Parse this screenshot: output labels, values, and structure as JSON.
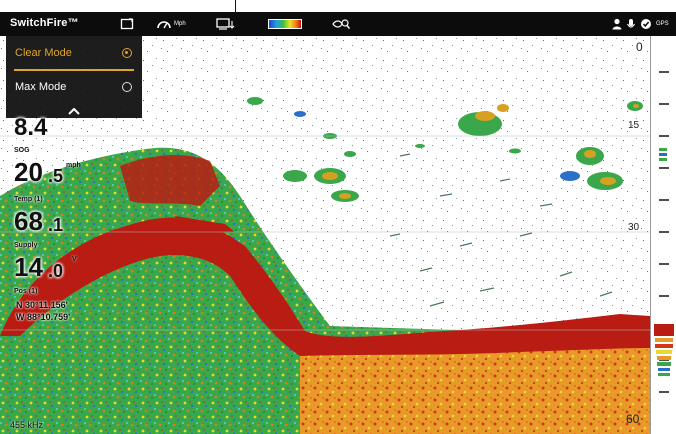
{
  "topbar": {
    "brand": "SwitchFire™",
    "speed_readout": "Mph",
    "right_label": "GPS"
  },
  "mode_menu": {
    "items": [
      {
        "label": "Clear Mode",
        "selected": true
      },
      {
        "label": "Max Mode",
        "selected": false
      }
    ],
    "accent": "#e0a52a"
  },
  "digital_readouts": {
    "depth": {
      "value_main": "8.4"
    },
    "sog": {
      "label": "SOG",
      "value_main": "20",
      "value_decimal": ".5",
      "unit": "mph"
    },
    "temp": {
      "label": "Temp (1)",
      "value_main": "68",
      "value_decimal": ".1"
    },
    "supply": {
      "label": "Supply",
      "value_main": "14",
      "value_decimal": ".0",
      "unit": "V"
    },
    "position": {
      "label": "Pos (1)",
      "lat": "N 30°11.156'",
      "lon": "W 88°10.759'"
    }
  },
  "frequency_label": "455 kHz",
  "depth_scale": {
    "top": "0",
    "mark1": "15",
    "mark2": "30",
    "mark3": "",
    "bottom": "60"
  },
  "colors": {
    "topbar": "#0c0c0c",
    "bottom_return": "#b81c12",
    "fish_arch": "#d8a020"
  }
}
